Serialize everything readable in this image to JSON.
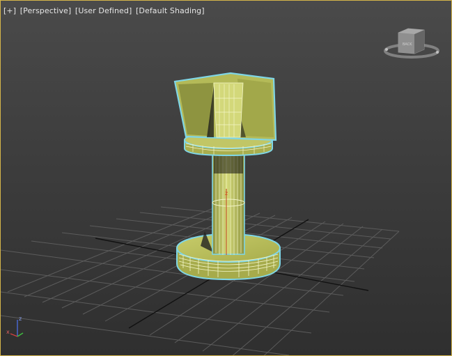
{
  "viewport": {
    "labels": [
      "[+]",
      "[Perspective]",
      "[User Defined]",
      "[Default Shading]"
    ]
  },
  "viewcube": {
    "face_label": "BACK",
    "icon": "viewcube-icon"
  },
  "axis_gizmo": {
    "z_label": "z",
    "x_label": "x",
    "icon": "axis-tripod-icon"
  },
  "colors": {
    "viewport_border": "#d6b64a",
    "selection_outline": "#7fd6e6",
    "model_fill": "#b7bd5a",
    "wire": "#f3f6c8",
    "grid": "#5a5a5a",
    "grid_axis": "#111111"
  }
}
